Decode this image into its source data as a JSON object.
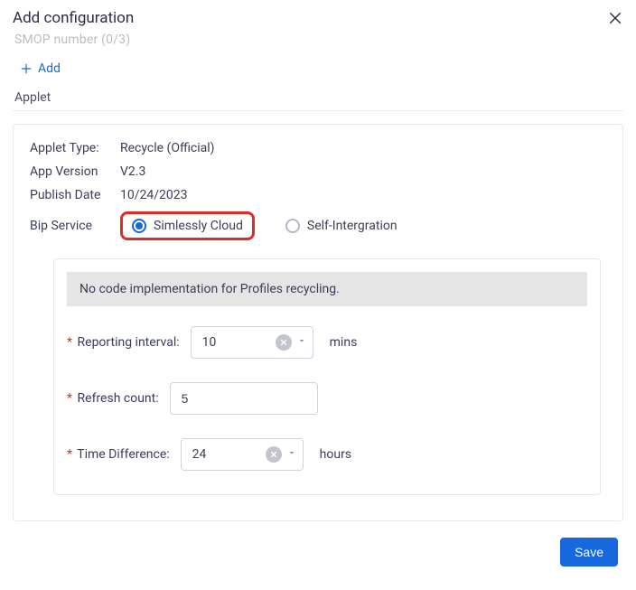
{
  "dialog": {
    "title": "Add configuration",
    "truncated_row": "SMOP number (0/3)"
  },
  "buttons": {
    "add": "Add",
    "save": "Save"
  },
  "section": "Applet",
  "applet": {
    "type_label": "Applet Type:",
    "type_value": "Recycle (Official)",
    "version_label": "App Version",
    "version_value": "V2.3",
    "publish_label": "Publish Date",
    "publish_value": "10/24/2023",
    "bip_label": "Bip Service",
    "bip_opt_simlessly": "Simlessly Cloud",
    "bip_opt_selfint": "Self-Intergration"
  },
  "simlessly": {
    "banner": "No code implementation for Profiles recycling.",
    "reporting_label": "Reporting interval:",
    "reporting_value": "10",
    "reporting_unit": "mins",
    "refresh_label": "Refresh count:",
    "refresh_value": "5",
    "time_diff_label": "Time Difference:",
    "time_diff_value": "24",
    "time_diff_unit": "hours"
  }
}
